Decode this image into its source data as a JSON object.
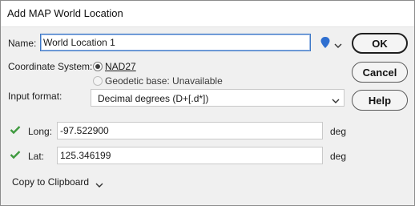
{
  "dialog": {
    "title": "Add MAP World Location"
  },
  "name": {
    "label": "Name:",
    "value": "World Location 1"
  },
  "coordinate_system": {
    "label": "Coordinate System:",
    "options": [
      {
        "label": "NAD27",
        "selected": true,
        "enabled": true
      },
      {
        "label": "Geodetic base: Unavailable",
        "selected": false,
        "enabled": false
      }
    ]
  },
  "input_format": {
    "label": "Input format:",
    "selected": "Decimal degrees (D+[.d*])"
  },
  "long": {
    "label": "Long:",
    "value": "-97.522900",
    "unit": "deg"
  },
  "lat": {
    "label": "Lat:",
    "value": "125.346199",
    "unit": "deg"
  },
  "buttons": {
    "ok": "OK",
    "cancel": "Cancel",
    "help": "Help"
  },
  "copy": {
    "label": "Copy to Clipboard"
  },
  "colors": {
    "pin": "#2f6fd0",
    "check": "#3f9a3f",
    "focus": "#3c77c6"
  },
  "icons": [
    "location-pin-icon",
    "chevron-down-icon",
    "checkmark-icon"
  ]
}
